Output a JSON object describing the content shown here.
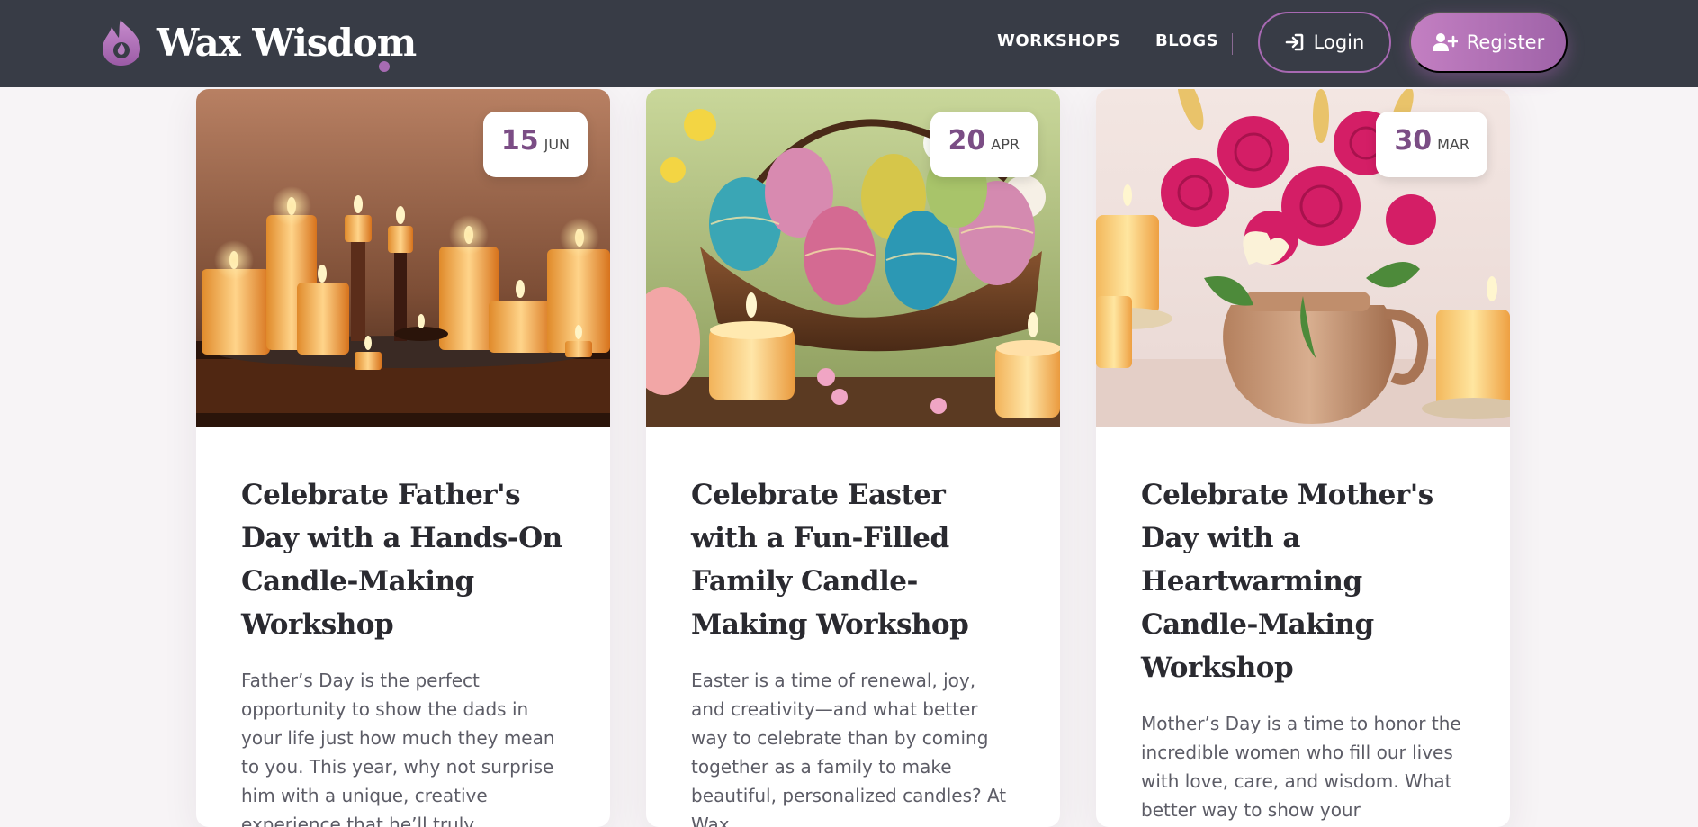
{
  "brand": {
    "name": "Wax Wisdom",
    "accent": "#a76bb3",
    "header_bg": "#383c46"
  },
  "nav": {
    "workshops": "WORKSHOPS",
    "blogs": "BLOGS",
    "login": "Login",
    "register": "Register"
  },
  "cards": [
    {
      "day": "15",
      "month": "JUN",
      "title": "Celebrate Father's Day with a Hands-On Candle-Making Workshop",
      "excerpt": "Father’s Day is the perfect opportunity to show the dads in your life just how much they mean to you. This year, why not surprise him with a unique, creative experience that he’ll truly appreciate? At Wax Wisdom, we’re"
    },
    {
      "day": "20",
      "month": "APR",
      "title": "Celebrate Easter with a Fun-Filled Family Candle-Making Workshop",
      "excerpt": "Easter is a time of renewal, joy, and creativity—and what better way to celebrate than by coming together as a family to make beautiful, personalized candles? At Wax"
    },
    {
      "day": "30",
      "month": "MAR",
      "title": "Celebrate Mother's Day with a Heartwarming Candle-Making Workshop",
      "excerpt": "Mother’s Day is a time to honor the incredible women who fill our lives with love, care, and wisdom. What better way to show your appreciation than by creating"
    }
  ]
}
